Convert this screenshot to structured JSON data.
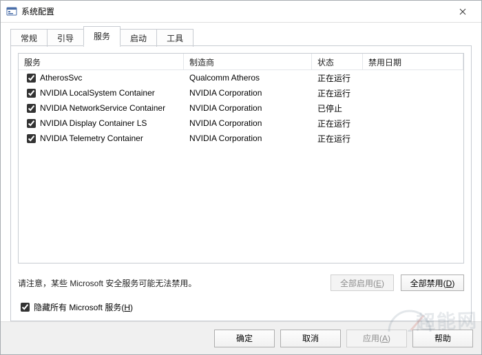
{
  "window": {
    "title": "系统配置"
  },
  "tabs": [
    {
      "label": "常规"
    },
    {
      "label": "引导"
    },
    {
      "label": "服务"
    },
    {
      "label": "启动"
    },
    {
      "label": "工具"
    }
  ],
  "active_tab_index": 2,
  "columns": {
    "service": "服务",
    "manufacturer": "制造商",
    "status": "状态",
    "disable_date": "禁用日期"
  },
  "services": [
    {
      "checked": true,
      "name": "AtherosSvc",
      "manufacturer": "Qualcomm Atheros",
      "status": "正在运行",
      "disable_date": ""
    },
    {
      "checked": true,
      "name": "NVIDIA LocalSystem Container",
      "manufacturer": "NVIDIA Corporation",
      "status": "正在运行",
      "disable_date": ""
    },
    {
      "checked": true,
      "name": "NVIDIA NetworkService Container",
      "manufacturer": "NVIDIA Corporation",
      "status": "已停止",
      "disable_date": ""
    },
    {
      "checked": true,
      "name": "NVIDIA Display Container LS",
      "manufacturer": "NVIDIA Corporation",
      "status": "正在运行",
      "disable_date": ""
    },
    {
      "checked": true,
      "name": "NVIDIA Telemetry Container",
      "manufacturer": "NVIDIA Corporation",
      "status": "正在运行",
      "disable_date": ""
    }
  ],
  "notes": {
    "warning": "请注意，某些 Microsoft 安全服务可能无法禁用。",
    "hide_ms_label": "隐藏所有 Microsoft 服务",
    "hide_ms_mn": "H",
    "hide_ms_checked": true
  },
  "buttons": {
    "enable_all": "全部启用",
    "enable_all_mn": "E",
    "disable_all": "全部禁用",
    "disable_all_mn": "D",
    "ok": "确定",
    "cancel": "取消",
    "apply": "应用",
    "apply_mn": "A",
    "help": "帮助"
  },
  "watermark": "超能网"
}
